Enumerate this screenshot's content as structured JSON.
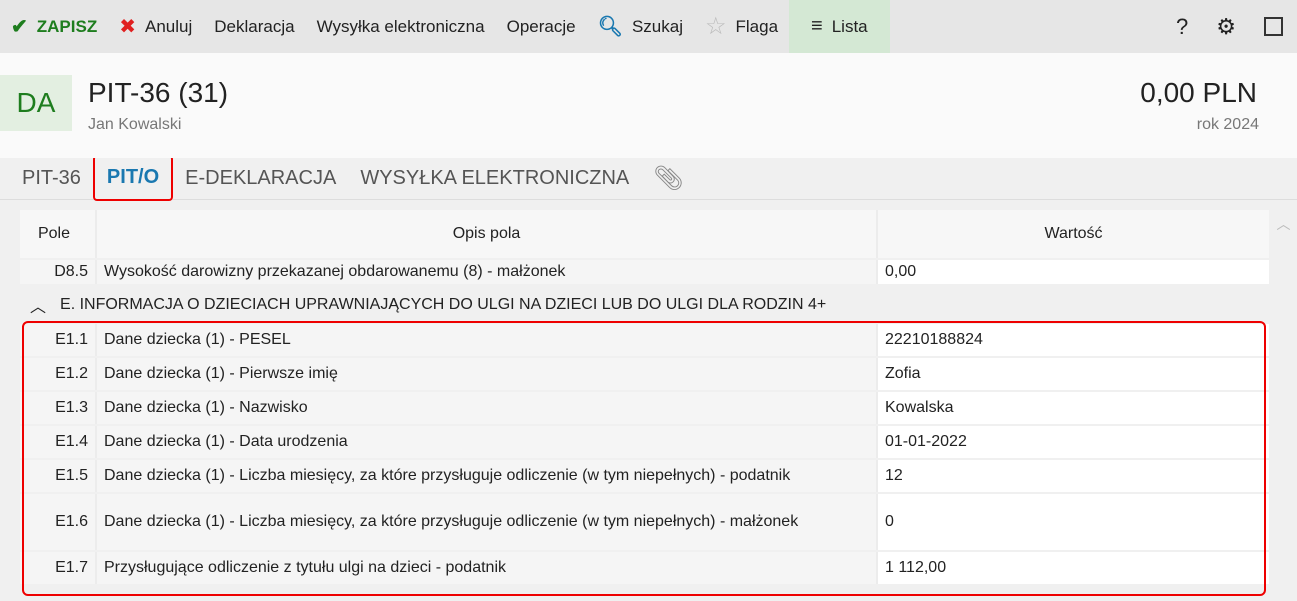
{
  "toolbar": {
    "save": "ZAPISZ",
    "cancel": "Anuluj",
    "declaration": "Deklaracja",
    "electronic": "Wysyłka elektroniczna",
    "operations": "Operacje",
    "search": "Szukaj",
    "flag": "Flaga",
    "list": "Lista",
    "help": "?"
  },
  "header": {
    "badge": "DA",
    "title": "PIT-36 (31)",
    "person": "Jan Kowalski",
    "amount": "0,00 PLN",
    "year": "rok 2024"
  },
  "tabs": [
    "PIT-36",
    "PIT/O",
    "E-DEKLARACJA",
    "WYSYŁKA ELEKTRONICZNA"
  ],
  "table": {
    "headers": [
      "Pole",
      "Opis pola",
      "Wartość"
    ],
    "top_row": {
      "field": "D8.5",
      "desc": "Wysokość darowizny przekazanej obdarowanemu (8) - małżonek",
      "value": "0,00"
    },
    "section": "E. INFORMACJA O DZIECIACH UPRAWNIAJĄCYCH DO ULGI NA DZIECI LUB DO ULGI DLA RODZIN 4+",
    "rows": [
      {
        "field": "E1.1",
        "desc": "Dane dziecka (1) - PESEL",
        "value": "22210188824"
      },
      {
        "field": "E1.2",
        "desc": "Dane dziecka (1) - Pierwsze imię",
        "value": "Zofia"
      },
      {
        "field": "E1.3",
        "desc": "Dane dziecka (1) - Nazwisko",
        "value": "Kowalska"
      },
      {
        "field": "E1.4",
        "desc": "Dane dziecka (1) - Data urodzenia",
        "value": "01-01-2022"
      },
      {
        "field": "E1.5",
        "desc": "Dane dziecka (1) - Liczba miesięcy, za które przysługuje odliczenie (w tym niepełnych) - podatnik",
        "value": "12"
      },
      {
        "field": "E1.6",
        "desc": "Dane dziecka (1) - Liczba miesięcy, za które przysługuje odliczenie (w tym niepełnych) - małżonek",
        "value": "0"
      },
      {
        "field": "E1.7",
        "desc": "Przysługujące odliczenie z tytułu ulgi na dzieci - podatnik",
        "value": "1 112,00"
      }
    ]
  }
}
